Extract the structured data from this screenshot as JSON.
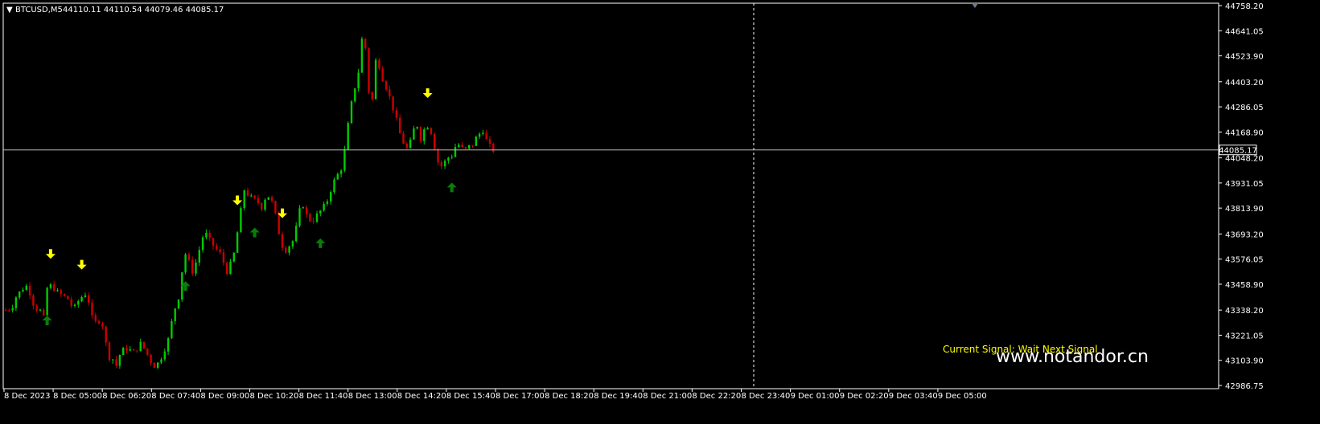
{
  "header": {
    "symbol": "BTCUSD,M5",
    "ohlc": "44110.11 44110.54 44079.46 44085.17"
  },
  "current_price_label": "44085.17",
  "signal_text": "Current Signal: Wait Next Signal",
  "watermark": "www.notandor.cn",
  "colors": {
    "background": "#000000",
    "bull": "#00cc00",
    "bear": "#cc0000",
    "buy_arrow": "#0a7d0a",
    "sell_arrow": "#ffff00",
    "price_line": "#c0c0c0",
    "axis": "#ffffff",
    "signal_text": "#ffff00"
  },
  "chart_data": {
    "type": "candlestick",
    "instrument": "BTCUSD",
    "timeframe": "M5",
    "ylim": [
      42986.75,
      44758.2
    ],
    "y_ticks": [
      "44758.20",
      "44641.05",
      "44523.90",
      "44403.20",
      "44286.05",
      "44168.90",
      "44048.20",
      "43931.05",
      "43813.90",
      "43693.20",
      "43576.05",
      "43458.90",
      "43338.20",
      "43221.05",
      "43103.90",
      "42986.75"
    ],
    "x_ticks": [
      "8 Dec 2023",
      "8 Dec 05:00",
      "8 Dec 06:20",
      "8 Dec 07:40",
      "8 Dec 09:00",
      "8 Dec 10:20",
      "8 Dec 11:40",
      "8 Dec 13:00",
      "8 Dec 14:20",
      "8 Dec 15:40",
      "8 Dec 17:00",
      "8 Dec 18:20",
      "8 Dec 19:40",
      "8 Dec 21:00",
      "8 Dec 22:20",
      "8 Dec 23:40",
      "9 Dec 01:00",
      "9 Dec 02:20",
      "9 Dec 03:40",
      "9 Dec 05:00"
    ],
    "close_path": [
      [
        0,
        43338
      ],
      [
        1,
        43345
      ],
      [
        2,
        43360
      ],
      [
        3,
        43400
      ],
      [
        4,
        43420
      ],
      [
        5,
        43440
      ],
      [
        6,
        43450
      ],
      [
        7,
        43420
      ],
      [
        8,
        43370
      ],
      [
        9,
        43345
      ],
      [
        10,
        43335
      ],
      [
        11,
        43300
      ],
      [
        12,
        43440
      ],
      [
        13,
        43450
      ],
      [
        14,
        43440
      ],
      [
        15,
        43420
      ],
      [
        16,
        43410
      ],
      [
        17,
        43400
      ],
      [
        18,
        43390
      ],
      [
        19,
        43360
      ],
      [
        20,
        43350
      ],
      [
        21,
        43380
      ],
      [
        22,
        43400
      ],
      [
        23,
        43415
      ],
      [
        24,
        43380
      ],
      [
        25,
        43300
      ],
      [
        26,
        43280
      ],
      [
        27,
        43290
      ],
      [
        28,
        43270
      ],
      [
        29,
        43180
      ],
      [
        30,
        43120
      ],
      [
        31,
        43110
      ],
      [
        32,
        43080
      ],
      [
        33,
        43130
      ],
      [
        34,
        43150
      ],
      [
        35,
        43160
      ],
      [
        36,
        43150
      ],
      [
        37,
        43140
      ],
      [
        38,
        43160
      ],
      [
        39,
        43180
      ],
      [
        40,
        43160
      ],
      [
        41,
        43130
      ],
      [
        42,
        43100
      ],
      [
        43,
        43080
      ],
      [
        44,
        43090
      ],
      [
        45,
        43120
      ],
      [
        46,
        43160
      ],
      [
        47,
        43200
      ],
      [
        48,
        43280
      ],
      [
        49,
        43350
      ],
      [
        50,
        43400
      ],
      [
        51,
        43520
      ],
      [
        52,
        43600
      ],
      [
        53,
        43560
      ],
      [
        54,
        43520
      ],
      [
        55,
        43560
      ],
      [
        56,
        43620
      ],
      [
        57,
        43680
      ],
      [
        58,
        43690
      ],
      [
        59,
        43660
      ],
      [
        60,
        43640
      ],
      [
        61,
        43620
      ],
      [
        62,
        43600
      ],
      [
        63,
        43560
      ],
      [
        64,
        43520
      ],
      [
        65,
        43550
      ],
      [
        66,
        43600
      ],
      [
        67,
        43700
      ],
      [
        68,
        43800
      ],
      [
        69,
        43900
      ],
      [
        70,
        43880
      ],
      [
        71,
        43860
      ],
      [
        72,
        43850
      ],
      [
        73,
        43840
      ],
      [
        74,
        43820
      ],
      [
        75,
        43860
      ],
      [
        76,
        43870
      ],
      [
        77,
        43840
      ],
      [
        78,
        43780
      ],
      [
        79,
        43700
      ],
      [
        80,
        43640
      ],
      [
        81,
        43620
      ],
      [
        82,
        43640
      ],
      [
        83,
        43660
      ],
      [
        84,
        43720
      ],
      [
        85,
        43800
      ],
      [
        86,
        43830
      ],
      [
        87,
        43780
      ],
      [
        88,
        43760
      ],
      [
        89,
        43760
      ],
      [
        90,
        43780
      ],
      [
        91,
        43800
      ],
      [
        92,
        43820
      ],
      [
        93,
        43850
      ],
      [
        94,
        43900
      ],
      [
        95,
        43940
      ],
      [
        96,
        43970
      ],
      [
        97,
        44000
      ],
      [
        98,
        44080
      ],
      [
        99,
        44200
      ],
      [
        100,
        44300
      ],
      [
        101,
        44380
      ],
      [
        102,
        44450
      ],
      [
        103,
        44600
      ],
      [
        104,
        44560
      ],
      [
        105,
        44360
      ],
      [
        106,
        44320
      ],
      [
        107,
        44500
      ],
      [
        108,
        44480
      ],
      [
        109,
        44420
      ],
      [
        110,
        44380
      ],
      [
        111,
        44330
      ],
      [
        112,
        44280
      ],
      [
        113,
        44220
      ],
      [
        114,
        44160
      ],
      [
        115,
        44120
      ],
      [
        116,
        44090
      ],
      [
        117,
        44120
      ],
      [
        118,
        44180
      ],
      [
        119,
        44200
      ],
      [
        120,
        44140
      ],
      [
        121,
        44180
      ],
      [
        122,
        44200
      ],
      [
        123,
        44170
      ],
      [
        124,
        44100
      ],
      [
        125,
        44030
      ],
      [
        126,
        44010
      ],
      [
        127,
        44030
      ],
      [
        128,
        44050
      ],
      [
        129,
        44060
      ],
      [
        130,
        44100
      ],
      [
        131,
        44110
      ],
      [
        132,
        44090
      ],
      [
        133,
        44085
      ],
      [
        134,
        44100
      ],
      [
        135,
        44110
      ],
      [
        136,
        44140
      ],
      [
        137,
        44160
      ],
      [
        138,
        44180
      ],
      [
        139,
        44130
      ],
      [
        140,
        44100
      ],
      [
        141,
        44085
      ]
    ]
  },
  "signals": {
    "buy": [
      12,
      52,
      72,
      91,
      129
    ],
    "sell": [
      13,
      22,
      67,
      80,
      122
    ]
  }
}
